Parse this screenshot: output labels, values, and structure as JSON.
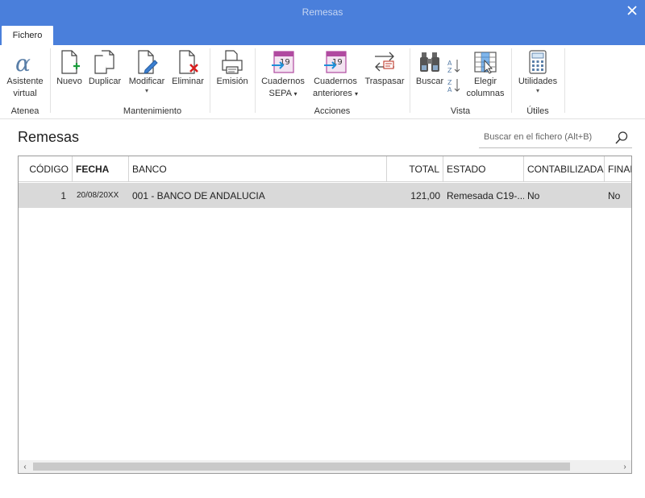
{
  "window": {
    "title": "Remesas"
  },
  "tabs": [
    {
      "label": "Fichero"
    }
  ],
  "ribbon": {
    "groups": [
      {
        "label": "Atenea"
      },
      {
        "label": "Mantenimiento"
      },
      {
        "label": "Acciones"
      },
      {
        "label": "Vista"
      },
      {
        "label": "Útiles"
      }
    ],
    "buttons": {
      "asistente": [
        "Asistente",
        "virtual"
      ],
      "nuevo": "Nuevo",
      "duplicar": "Duplicar",
      "modificar": "Modificar",
      "eliminar": "Eliminar",
      "emision": "Emisión",
      "cuadernos_sepa": [
        "Cuadernos",
        "SEPA"
      ],
      "cuadernos_anteriores": [
        "Cuadernos",
        "anteriores"
      ],
      "traspasar": "Traspasar",
      "buscar": "Buscar",
      "elegir_columnas": [
        "Elegir",
        "columnas"
      ],
      "utilidades": "Utilidades"
    },
    "icons": {
      "asistente": "alpha-icon",
      "nuevo": "new-document-icon",
      "duplicar": "duplicate-icon",
      "modificar": "edit-document-icon",
      "eliminar": "delete-document-icon",
      "emision": "printer-icon",
      "cuadernos_sepa": "calendar-arrow-icon",
      "cuadernos_anteriores": "calendar-arrow-icon",
      "traspasar": "transfer-icon",
      "buscar": "binoculars-icon",
      "sort_az": "sort-az-icon",
      "sort_za": "sort-za-icon",
      "elegir_columnas": "columns-icon",
      "utilidades": "calculator-icon"
    },
    "sort": {
      "az_top": "A",
      "az_bottom": "Z",
      "za_top": "Z",
      "za_bottom": "A"
    }
  },
  "page": {
    "title": "Remesas"
  },
  "search": {
    "placeholder": "Buscar en el fichero (Alt+B)"
  },
  "table": {
    "columns": [
      "CÓDIGO",
      "FECHA",
      "BANCO",
      "TOTAL",
      "ESTADO",
      "CONTABILIZADA",
      "FINAN"
    ],
    "rows": [
      {
        "codigo": "1",
        "fecha": "20/08/20XX",
        "banco": "001 - BANCO DE ANDALUCIA",
        "total": "121,00",
        "estado": "Remesada C19-...",
        "contabilizada": "No",
        "finan": "No"
      }
    ]
  },
  "colors": {
    "accent": "#4a7fdb",
    "selected_row": "#d9d9d9"
  }
}
